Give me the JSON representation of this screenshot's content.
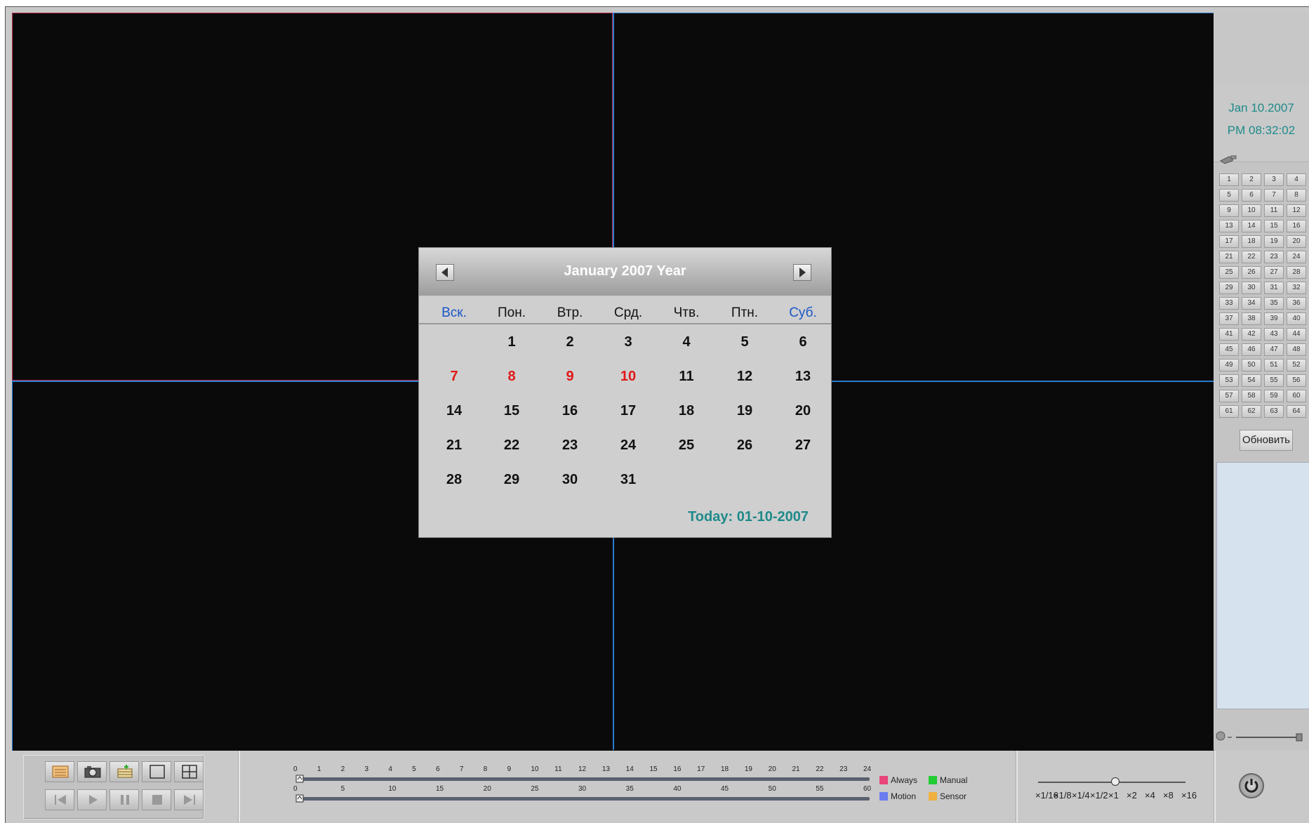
{
  "clock": {
    "date": "Jan 10.2007",
    "time": "PM 08:32:02"
  },
  "cameras": [
    "1",
    "2",
    "3",
    "4",
    "5",
    "6",
    "7",
    "8",
    "9",
    "10",
    "11",
    "12",
    "13",
    "14",
    "15",
    "16",
    "17",
    "18",
    "19",
    "20",
    "21",
    "22",
    "23",
    "24",
    "25",
    "26",
    "27",
    "28",
    "29",
    "30",
    "31",
    "32",
    "33",
    "34",
    "35",
    "36",
    "37",
    "38",
    "39",
    "40",
    "41",
    "42",
    "43",
    "44",
    "45",
    "46",
    "47",
    "48",
    "49",
    "50",
    "51",
    "52",
    "53",
    "54",
    "55",
    "56",
    "57",
    "58",
    "59",
    "60",
    "61",
    "62",
    "63",
    "64"
  ],
  "refresh_label": "Обновить",
  "calendar": {
    "title": "January  2007 Year",
    "weekdays": [
      {
        "label": "Вск.",
        "color": "#1a56c8"
      },
      {
        "label": "Пон.",
        "color": "#111111"
      },
      {
        "label": "Втр.",
        "color": "#111111"
      },
      {
        "label": "Срд.",
        "color": "#111111"
      },
      {
        "label": "Чтв.",
        "color": "#111111"
      },
      {
        "label": "Птн.",
        "color": "#111111"
      },
      {
        "label": "Суб.",
        "color": "#1a56c8"
      }
    ],
    "first_weekday_index": 1,
    "days_in_month": 31,
    "highlighted_days": [
      7,
      8,
      9,
      10
    ],
    "highlight_color": "#e01818",
    "today_label": "Today: 01-10-2007"
  },
  "timeline": {
    "hours": [
      "0",
      "1",
      "2",
      "3",
      "4",
      "5",
      "6",
      "7",
      "8",
      "9",
      "10",
      "11",
      "12",
      "13",
      "14",
      "15",
      "16",
      "17",
      "18",
      "19",
      "20",
      "21",
      "22",
      "23",
      "24"
    ],
    "minutes": [
      "0",
      "5",
      "10",
      "15",
      "20",
      "25",
      "30",
      "35",
      "40",
      "45",
      "50",
      "55",
      "60"
    ]
  },
  "legend": [
    {
      "label": "Always",
      "color": "#e8457a"
    },
    {
      "label": "Manual",
      "color": "#22cc33"
    },
    {
      "label": "Motion",
      "color": "#6b7cf0"
    },
    {
      "label": "Sensor",
      "color": "#f0b040"
    }
  ],
  "speed": {
    "options": [
      "×1/16",
      "×1/8",
      "×1/4",
      "×1/2",
      "×1",
      "×2",
      "×4",
      "×8",
      "×16"
    ],
    "selected": "×1"
  },
  "colors": {
    "accent": "#2a7bd0",
    "selected_cell": "#c03050",
    "clock": "#1e8a8a"
  }
}
